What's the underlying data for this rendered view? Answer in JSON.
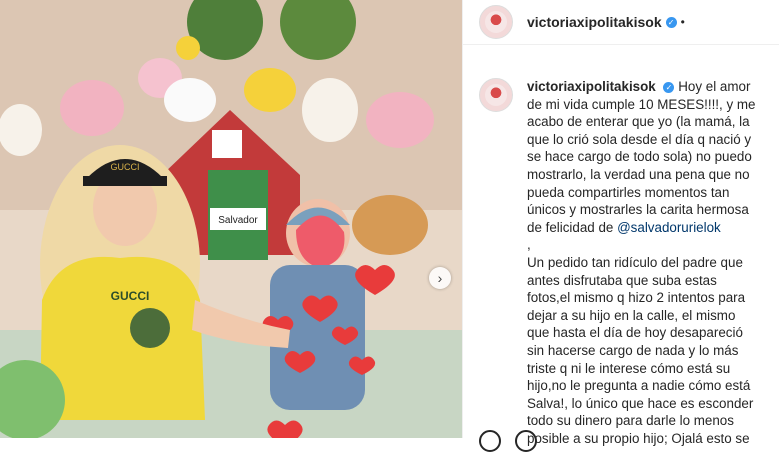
{
  "post": {
    "username": "victoriaxipolitakisok",
    "more": "•",
    "caption_lines": [
      "Hoy el amor",
      "de mi vida cumple 10 MESES!!!!, y me",
      "acabo de enterar que yo (la mamá, la",
      "que lo crió sola desde el día q nació y",
      "se hace cargo de todo sola) no puedo",
      "mostrarlo, la verdad una pena que no",
      "pueda compartirles momentos tan",
      "únicos y mostrarles la carita hermosa",
      "de felicidad de ",
      ",",
      "Un pedido tan ridículo del padre que",
      "antes disfrutaba que suba estas",
      "fotos,el mismo q hizo 2 intentos para",
      "dejar a su hijo en la calle, el mismo",
      "que hasta el día de hoy desapareció",
      "sin hacerse cargo de nada y lo más",
      "triste q ni le interese cómo está su",
      "hijo,no le pregunta a nadie cómo está",
      "Salva!, lo único que hace es esconder",
      "todo su dinero para darle lo menos",
      "posible a su propio hijo; Ojalá esto se"
    ],
    "mention": "@salvadorurielok"
  },
  "photo": {
    "cake_sign": "Salvador",
    "cap_text": "GUCCI",
    "shirt_text": "GUCCI"
  },
  "icons": {
    "verified": "verified-badge-icon",
    "next": "chevron-right-icon"
  },
  "colors": {
    "verified": "#3897f0",
    "mention": "#00376b"
  }
}
